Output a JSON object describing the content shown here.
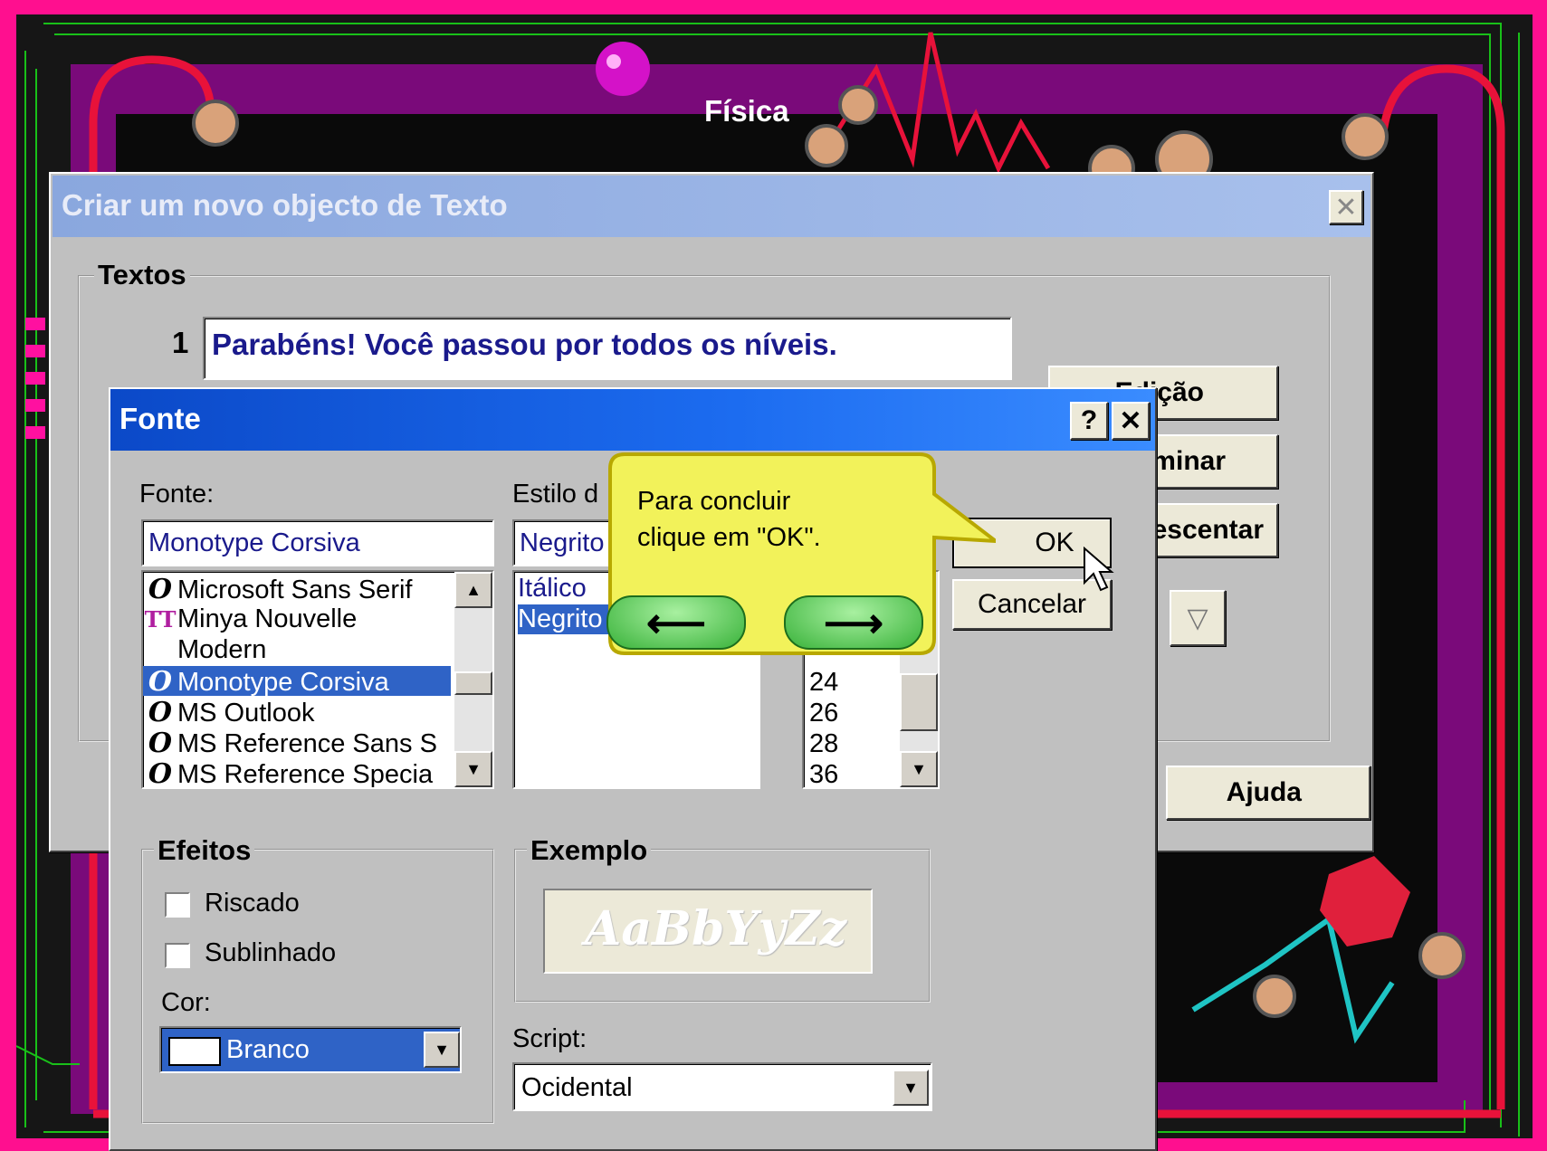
{
  "background": {
    "title": "Física"
  },
  "text_dialog": {
    "title": "Criar um novo objecto de Texto",
    "group_label": "Textos",
    "line_number": "1",
    "line_text": "Parabéns! Você passou por todos os níveis.",
    "buttons": {
      "edit": "Edição",
      "remove": "Eliminar",
      "add": "Acrescentar",
      "help": "Ajuda"
    }
  },
  "font_dialog": {
    "title": "Fonte",
    "help_glyph": "?",
    "font_label": "Fonte:",
    "font_value": "Monotype Corsiva",
    "font_list": [
      {
        "name": "Microsoft Sans Serif",
        "icon": "O",
        "selected": false
      },
      {
        "name": "Minya Nouvelle",
        "icon": "TT",
        "selected": false
      },
      {
        "name": "Modern",
        "icon": "",
        "selected": false
      },
      {
        "name": "Monotype Corsiva",
        "icon": "O",
        "selected": true
      },
      {
        "name": "MS Outlook",
        "icon": "O",
        "selected": false
      },
      {
        "name": "MS Reference Sans S",
        "icon": "O",
        "selected": false
      },
      {
        "name": "MS Reference Specia",
        "icon": "O",
        "selected": false
      }
    ],
    "style_label": "Estilo d",
    "style_value": "Negrito",
    "style_list": [
      {
        "name": "Itálico",
        "selected": false
      },
      {
        "name": "Negrito",
        "selected": true
      }
    ],
    "size_list": [
      "24",
      "26",
      "28",
      "36"
    ],
    "ok_label": "OK",
    "cancel_label": "Cancelar",
    "effects_label": "Efeitos",
    "strike_label": "Riscado",
    "underline_label": "Sublinhado",
    "color_label": "Cor:",
    "color_value": "Branco",
    "sample_label": "Exemplo",
    "sample_text": "AaBbYyZz",
    "script_label": "Script:",
    "script_value": "Ocidental"
  },
  "tooltip": {
    "line1": "Para concluir",
    "line2": "clique em \"OK\"."
  },
  "colors": {
    "page_border": "#ff0f8f",
    "dialog_gray": "#c0c0c0",
    "xp_title_blue": "#1c5fd8",
    "selection_blue": "#2f63c6",
    "tooltip_yellow": "#f2f25a",
    "nav_green": "#5fd15f"
  }
}
